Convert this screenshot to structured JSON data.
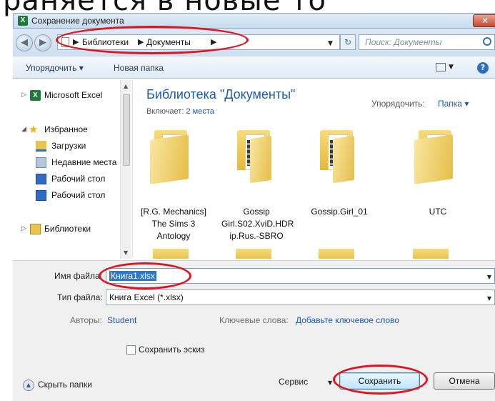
{
  "background_text": "раняется в новые   то",
  "window": {
    "title": "Сохранение документа",
    "close_glyph": "✕"
  },
  "address_bar": {
    "back_glyph": "◀",
    "forward_glyph": "▶",
    "breadcrumbs": [
      "Библиотеки",
      "Документы"
    ],
    "refresh_glyph": "↻",
    "search_placeholder": "Поиск: Документы"
  },
  "toolbar": {
    "organize_label": "Упорядочить ▾",
    "new_folder_label": "Новая папка",
    "help_glyph": "?"
  },
  "nav_pane": {
    "items": [
      {
        "label": "Microsoft Excel",
        "icon": "excel-icon"
      },
      {
        "label": "Избранное",
        "icon": "star-icon"
      },
      {
        "label": "Загрузки",
        "icon": "downloads-icon"
      },
      {
        "label": "Недавние места",
        "icon": "recent-places-icon"
      },
      {
        "label": "Рабочий стол",
        "icon": "desktop-icon"
      },
      {
        "label": "Рабочий стол",
        "icon": "desktop-icon"
      },
      {
        "label": "Библиотеки",
        "icon": "library-icon"
      }
    ]
  },
  "content": {
    "library_title": "Библиотека \"Документы\"",
    "includes_label": "Включает:",
    "includes_link": "2 места",
    "arrange_label": "Упорядочить:",
    "arrange_value": "Папка ▾",
    "folders": [
      {
        "name": "[R.G. Mechanics]\nThe Sims 3\nAntology",
        "media": false
      },
      {
        "name": "Gossip\nGirl.S02.XviD.HDR\nip.Rus.-SBRO",
        "media": true
      },
      {
        "name": "Gossip.Girl_01",
        "media": true
      },
      {
        "name": "UTC",
        "media": false
      }
    ]
  },
  "bottom": {
    "file_name_label": "Имя файла:",
    "file_name_value": "Книга1.xlsx",
    "file_type_label": "Тип файла:",
    "file_type_value": "Книга Excel (*.xlsx)",
    "authors_label": "Авторы:",
    "authors_value": "Student",
    "keywords_label": "Ключевые слова:",
    "keywords_value": "Добавьте ключевое слово",
    "thumbnail_label": "Сохранить эскиз",
    "hide_folders_label": "Скрыть папки",
    "service_label": "Сервис",
    "save_label": "Сохранить",
    "cancel_label": "Отмена"
  },
  "colors": {
    "annotation_red": "#e0141e",
    "link_blue": "#1e5aa8"
  }
}
